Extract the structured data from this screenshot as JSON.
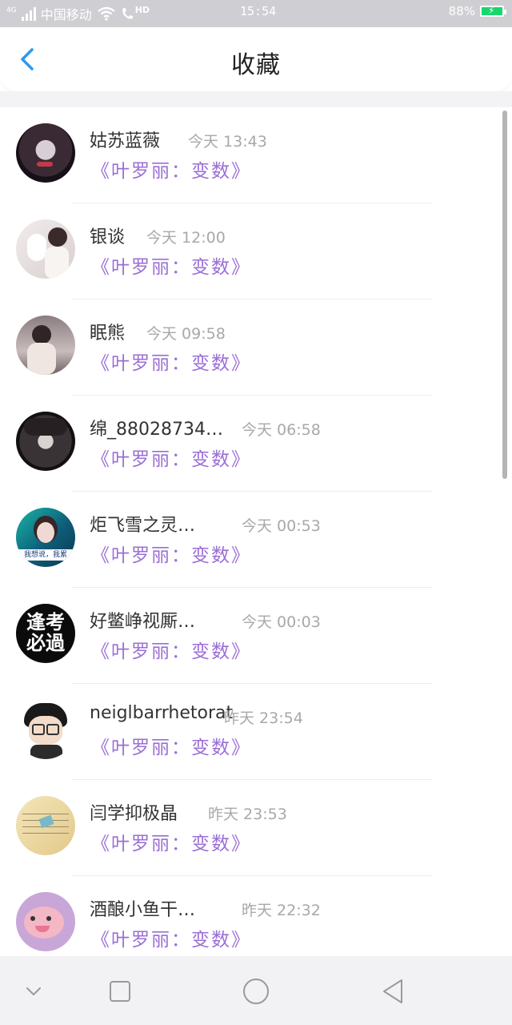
{
  "status_bar": {
    "carrier": "中国移动",
    "network": "4G",
    "hd": "HD",
    "time": "15:54",
    "battery": "88%"
  },
  "header": {
    "title": "收藏"
  },
  "items": [
    {
      "name": "姑苏蓝薇",
      "time": "今天 13:43",
      "song": "《叶罗丽：变数》"
    },
    {
      "name": "银谈",
      "time": "今天 12:00",
      "song": "《叶罗丽：变数》"
    },
    {
      "name": "眠熊",
      "time": "今天 09:58",
      "song": "《叶罗丽：变数》"
    },
    {
      "name": "绵_88028734…",
      "time": "今天 06:58",
      "song": "《叶罗丽：变数》"
    },
    {
      "name": "炬飞雪之灵…",
      "time": "今天 00:53",
      "song": "《叶罗丽：变数》"
    },
    {
      "name": "好鳖峥视厮…",
      "time": "今天 00:03",
      "song": "《叶罗丽：变数》"
    },
    {
      "name": "neiglbarrhetorat",
      "time": "昨天 23:54",
      "song": "《叶罗丽：变数》"
    },
    {
      "name": "闫学抑极晶",
      "time": "昨天 23:53",
      "song": "《叶罗丽：变数》"
    },
    {
      "name": "酒酿小鱼干…",
      "time": "昨天 22:32",
      "song": "《叶罗丽：变数》"
    }
  ],
  "avatar_texts": {
    "exam_top": "逢考",
    "exam_bottom": "必過",
    "banner": "我想说，我累"
  },
  "colors": {
    "accent_blue": "#2a9af0",
    "song_purple": "#9a6fd6",
    "time_gray": "#a8a8a8"
  }
}
